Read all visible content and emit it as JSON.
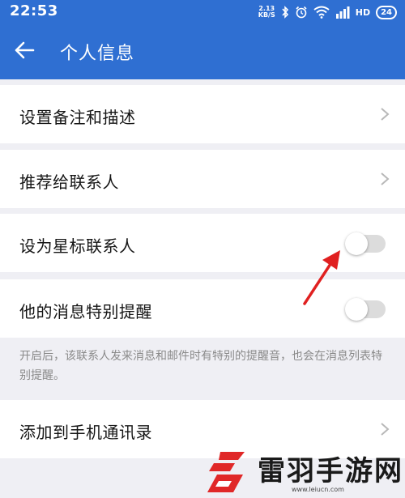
{
  "status_bar": {
    "time": "22:53",
    "net_speed_value": "2.13",
    "net_speed_unit": "KB/S",
    "hd_label": "HD",
    "battery": "24"
  },
  "header": {
    "title": "个人信息",
    "background_color": "#2f6fd2"
  },
  "settings": {
    "remark": {
      "label": "设置备注和描述"
    },
    "recommend": {
      "label": "推荐给联系人"
    },
    "star": {
      "label": "设为星标联系人",
      "enabled": false
    },
    "special_alert": {
      "label": "他的消息特别提醒",
      "enabled": false
    },
    "special_alert_note": "开启后，该联系人发来消息和邮件时有特别的提醒音，也会在消息列表特别提醒。",
    "add_contact": {
      "label": "添加到手机通讯录"
    }
  },
  "annotation": {
    "arrow_color": "#e02020"
  },
  "watermark": {
    "name": "雷羽手游网",
    "url": "www.leiucn.com"
  }
}
